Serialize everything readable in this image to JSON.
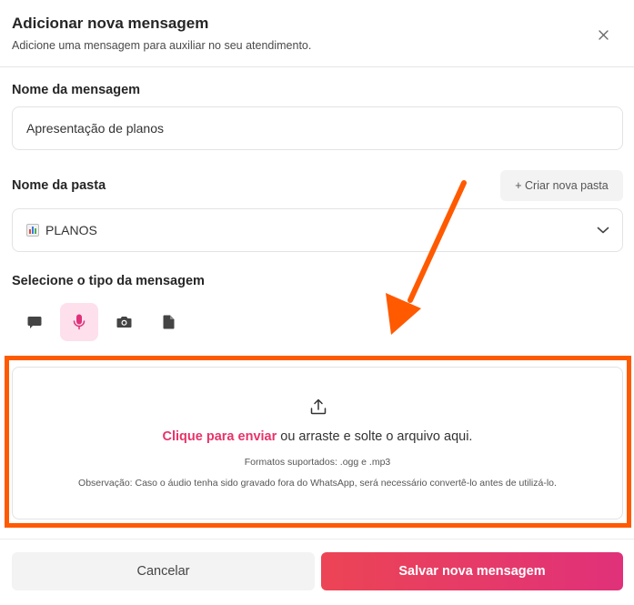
{
  "header": {
    "title": "Adicionar nova mensagem",
    "subtitle": "Adicione uma mensagem para auxiliar no seu atendimento.",
    "close_icon": "close-icon"
  },
  "message_name": {
    "label": "Nome da mensagem",
    "value": "Apresentação de planos"
  },
  "folder": {
    "label": "Nome da pasta",
    "new_folder_label": "+ Criar nova pasta",
    "selected": "PLANOS",
    "selected_icon": "bar-chart-emoji-icon"
  },
  "message_type": {
    "label": "Selecione o tipo da mensagem",
    "options": [
      {
        "name": "text",
        "icon": "chat-bubble-icon",
        "active": false
      },
      {
        "name": "audio",
        "icon": "microphone-icon",
        "active": true
      },
      {
        "name": "image",
        "icon": "camera-icon",
        "active": false
      },
      {
        "name": "document",
        "icon": "document-icon",
        "active": false
      }
    ]
  },
  "dropzone": {
    "link_text": "Clique para enviar",
    "text_rest": " ou arraste e solte o arquivo aqui.",
    "formats": "Formatos suportados: .ogg e .mp3",
    "note": "Observação: Caso o áudio tenha sido gravado fora do WhatsApp, será necessário convertê-lo antes de utilizá-lo."
  },
  "footer": {
    "cancel_label": "Cancelar",
    "save_label": "Salvar nova mensagem"
  },
  "colors": {
    "accent": "#e8336a",
    "highlight": "#ff5a00",
    "active_type_bg": "#fde0ec"
  }
}
